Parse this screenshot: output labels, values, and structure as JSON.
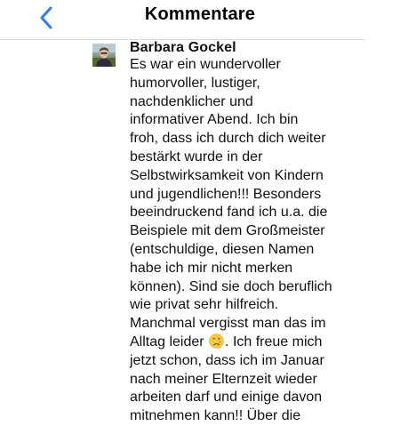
{
  "nav": {
    "title": "Kommentare",
    "back_icon": "chevron-left-icon",
    "accent_color": "#2f7cf6"
  },
  "comment": {
    "author": "Barbara Gockel",
    "avatar_icon": "user-avatar-photo",
    "text_part1": "Es war ein wundervoller\nhumorvoller, lustiger,\nnachdenklicher und\ninformativer Abend. Ich bin\nfroh, dass ich durch dich weiter\nbestärkt wurde in der\nSelbstwirksamkeit von Kindern\nund jugendlichen!!! Besonders\nbeeindruckend fand ich u.a. die\nBeispiele mit dem Großmeister\n(entschuldige, diesen Namen\nhabe ich mir nicht merken\nkönnen). Sind sie doch beruflich\nwie privat sehr hilfreich.\nManchmal vergisst man das im\nAlltag leider ",
    "emoji": "crying-face-emoji",
    "text_part2": ". Ich freue mich\njetzt schon, dass ich im Januar\nnach meiner Elternzeit wieder\narbeiten darf und einige davon\nmitnehmen kann!! Über die"
  }
}
